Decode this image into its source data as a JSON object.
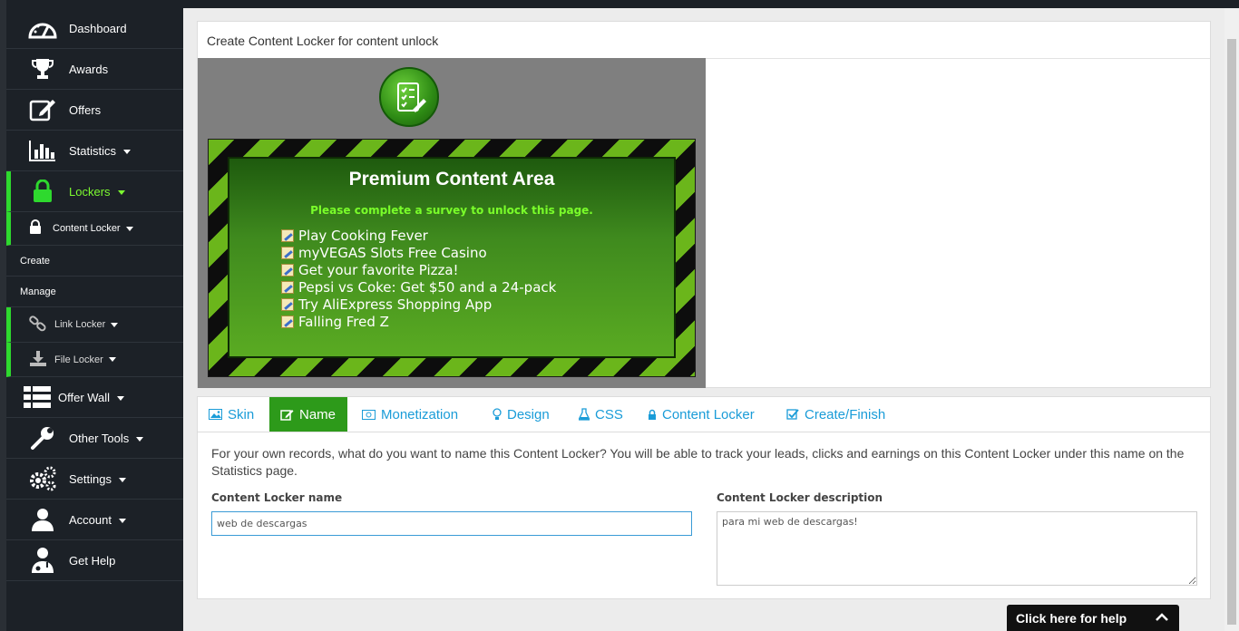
{
  "sidebar": {
    "dashboard": "Dashboard",
    "awards": "Awards",
    "offers": "Offers",
    "statistics": "Statistics",
    "lockers": "Lockers",
    "content_locker": "Content Locker",
    "create": "Create",
    "manage": "Manage",
    "link_locker": "Link Locker",
    "file_locker": "File Locker",
    "offer_wall": "Offer Wall",
    "other_tools": "Other Tools",
    "settings": "Settings",
    "account": "Account",
    "get_help": "Get Help"
  },
  "page_title": "Create Content Locker for content unlock",
  "preview": {
    "title": "Premium Content Area",
    "subtitle": "Please complete a survey to unlock this page.",
    "offers": [
      "Play Cooking Fever",
      "myVEGAS Slots Free Casino",
      "Get your favorite Pizza!",
      "Pepsi vs Coke: Get $50 and a 24-pack",
      "Try AliExpress Shopping App",
      "Falling Fred Z"
    ]
  },
  "tabs": {
    "skin": "Skin",
    "name": "Name",
    "monetization": "Monetization",
    "design": "Design",
    "css": "CSS",
    "content_locker": "Content Locker",
    "create_finish": "Create/Finish"
  },
  "form": {
    "description": "For your own records, what do you want to name this Content Locker? You will be able to track your leads, clicks and earnings on this Content Locker under this name on the Statistics page.",
    "name_label": "Content Locker name",
    "name_value": "web de descargas",
    "desc_label": "Content Locker description",
    "desc_value": "para mi web de descargas!"
  },
  "help": "Click here for help",
  "colors": {
    "accent_green": "#2d9a1a",
    "link_blue": "#1a9cd8",
    "sidebar_bg": "#1c2127"
  }
}
